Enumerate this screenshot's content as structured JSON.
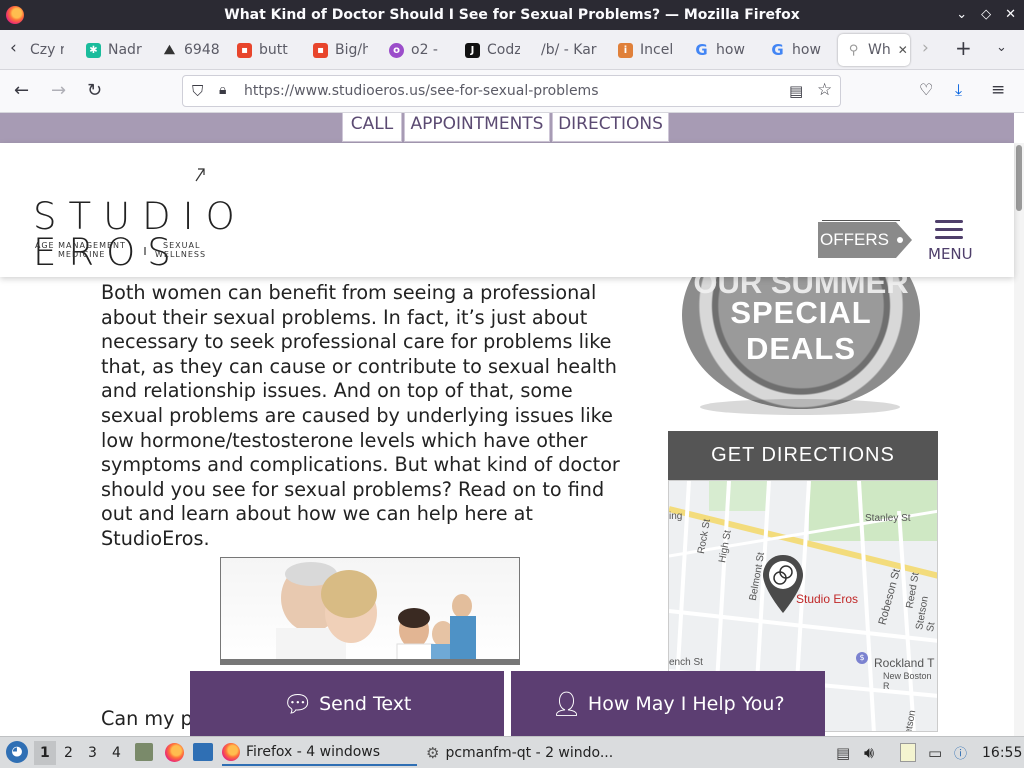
{
  "window": {
    "title": "What Kind of Doctor Should I See for Sexual Problems? — Mozilla Firefox",
    "controls": [
      "✕",
      "⤢",
      "✕"
    ]
  },
  "tabs": [
    {
      "label": "Czy r",
      "favicon": "page-icon",
      "color": "#888888"
    },
    {
      "label": "Nadr",
      "favicon": "star-icon",
      "color": "#1abc9c"
    },
    {
      "label": "6948",
      "favicon": "mountain-icon",
      "color": "#333333"
    },
    {
      "label": "butt",
      "favicon": "square-icon",
      "color": "#e8452c"
    },
    {
      "label": "Big/h",
      "favicon": "square-icon",
      "color": "#e8452c"
    },
    {
      "label": "o2 -",
      "favicon": "o-icon",
      "color": "#9b4dca"
    },
    {
      "label": "Codz",
      "favicon": "j-icon",
      "color": "#111111"
    },
    {
      "label": "/b/ - Kar",
      "favicon": "",
      "color": ""
    },
    {
      "label": "Incel",
      "favicon": "i-icon",
      "color": "#e0803a"
    },
    {
      "label": "how",
      "favicon": "google-icon",
      "color": "#4285f4"
    },
    {
      "label": "how",
      "favicon": "google-icon",
      "color": "#4285f4"
    },
    {
      "label": "Wh",
      "favicon": "link-icon",
      "color": "#999999",
      "active": true
    }
  ],
  "nav": {
    "url_host": "https://www.studioeros.us",
    "url_path": "/see-for-sexual-problems"
  },
  "site": {
    "top_buttons": [
      "CALL",
      "APPOINTMENTS",
      "DIRECTIONS"
    ],
    "logo": {
      "line1": "STUDIO",
      "line2": "EROS",
      "sub_left_1": "AGE MANAGEMENT",
      "sub_left_2": "MEDICINE",
      "sub_right_1": "SEXUAL",
      "sub_right_2": "WELLNESS"
    },
    "offers_label": "OFFERS",
    "menu_label": "MENU",
    "article_text": "Both women can benefit from seeing a professional about their sexual problems. In fact, it’s just about necessary to seek professional care for problems like that, as they can cause or contribute to sexual health and relationship issues. And on top of that, some sexual problems are caused by underlying issues like low hormone/testosterone levels which have other symptoms and complications. But what kind of doctor should you see for sexual problems? Read on to find out and learn about how we can help here at StudioEros.",
    "badge_top": "OUR SUMMER",
    "badge_main": "SPECIAL DEALS",
    "directions_heading": "GET DIRECTIONS",
    "map_labels": {
      "pin": "Studio Eros",
      "stanley": "Stanley St",
      "rock": "Rock St",
      "high": "High St",
      "belmont": "Belmont St",
      "robeson": "Robeson St",
      "reed": "Reed St",
      "stetson": "Stetson St",
      "rockland": "Rockland T",
      "newboston": "New Boston R",
      "ing": "ing",
      "french": "ench St",
      "stetson2": "Stetson St"
    },
    "partial_text": "Can my p",
    "chat_send": "Send Text",
    "chat_help": "How May I Help You?"
  },
  "taskbar": {
    "workspaces": [
      "1",
      "2",
      "3",
      "4"
    ],
    "firefox_task": "Firefox - 4 windows",
    "pcmanfm_task": "pcmanfm-qt - 2 windo...",
    "clock": "16:55"
  },
  "colors": {
    "brand_purple": "#5c3e72",
    "strip": "#a79bb4",
    "offers_gray": "#8a8a8a"
  }
}
